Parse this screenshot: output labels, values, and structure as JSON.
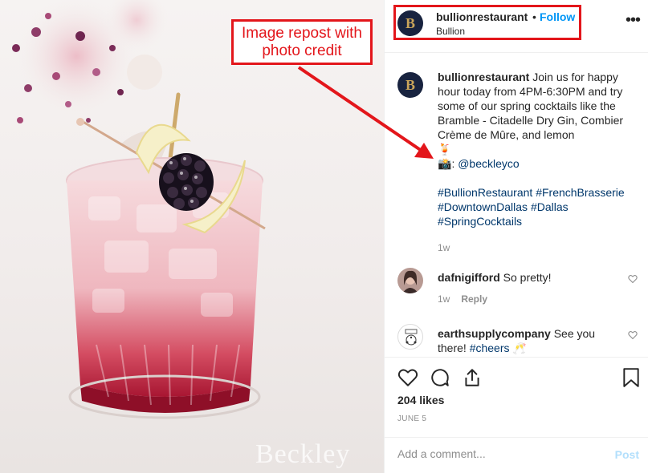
{
  "photo": {
    "watermark": "Beckley"
  },
  "header": {
    "avatar_letter": "B",
    "username": "bullionrestaurant",
    "separator": "•",
    "follow_label": "Follow",
    "location": "Bullion",
    "more_icon": "more-dots-icon"
  },
  "caption": {
    "avatar_letter": "B",
    "username": "bullionrestaurant",
    "text": "Join us for happy hour today from 4PM-6:30PM and try some of our spring cocktails like the Bramble - Citadelle Dry Gin, Combier Crème de Mûre, and lemon",
    "drink_emoji": "🍹",
    "camera_emoji": "📸",
    "credit_prefix": ":",
    "credit_handle": "@beckleyco",
    "hashtags": [
      "#BullionRestaurant",
      "#FrenchBrasserie",
      "#DowntownDallas",
      "#Dallas",
      "#SpringCocktails"
    ],
    "time": "1w"
  },
  "comments": [
    {
      "username": "dafnigifford",
      "text": "So pretty!",
      "time": "1w",
      "reply_label": "Reply"
    },
    {
      "username": "earthsupplycompany",
      "text": "See you there!",
      "hashtag": "#cheers",
      "emoji": "🥂"
    }
  ],
  "actions": {
    "icons": [
      "heart-icon",
      "comment-icon",
      "share-icon",
      "bookmark-icon"
    ],
    "likes": "204 likes",
    "date": "JUNE 5"
  },
  "add_comment": {
    "placeholder": "Add a comment...",
    "post_label": "Post"
  },
  "annotation": {
    "label": "Image repost with\nphoto credit",
    "color": "#e3161b"
  },
  "colors": {
    "follow_blue": "#0095f6",
    "link_blue": "#00376b",
    "avatar_navy": "#18233f",
    "avatar_gold": "#c9a45a"
  }
}
